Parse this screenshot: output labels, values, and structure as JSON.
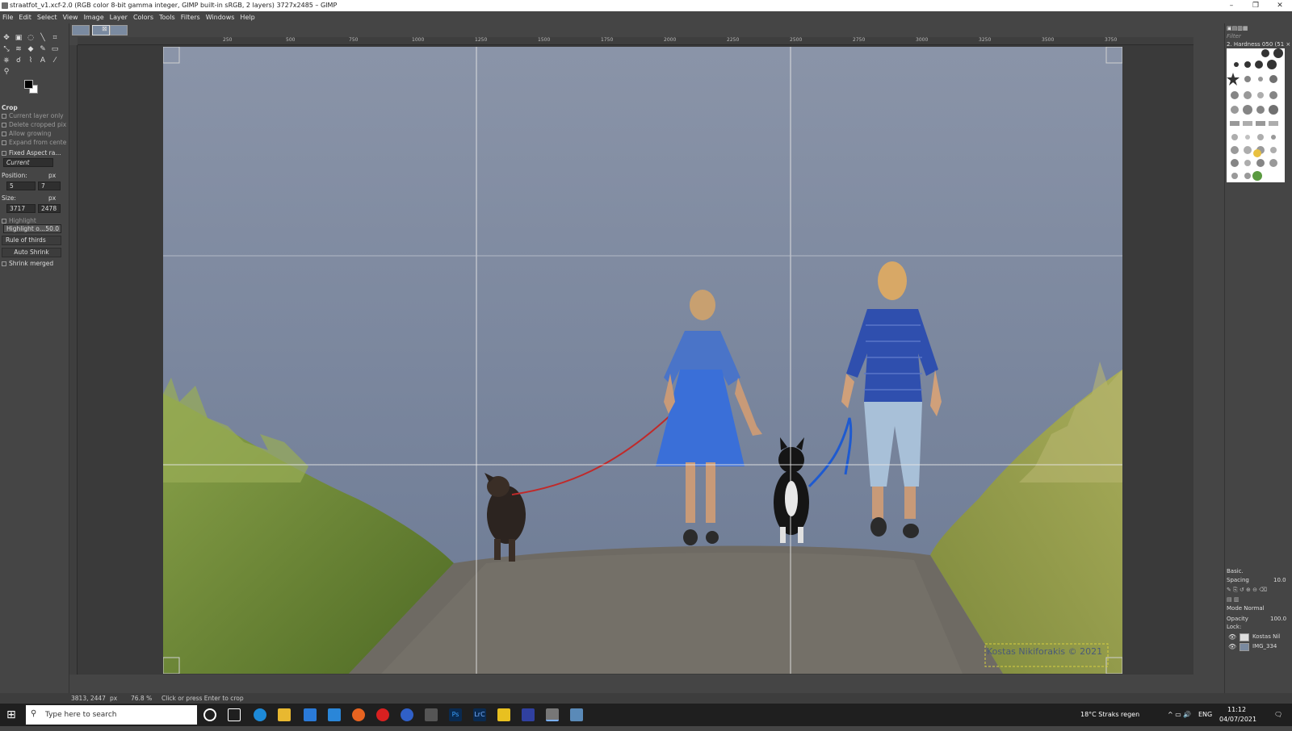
{
  "window": {
    "title": "straatfot_v1.xcf-2.0 (RGB color 8-bit gamma integer, GIMP built-in sRGB, 2 layers) 3727x2485 – GIMP",
    "controls": [
      "–",
      "❐",
      "✕"
    ]
  },
  "menubar": [
    "File",
    "Edit",
    "Select",
    "View",
    "Image",
    "Layer",
    "Colors",
    "Tools",
    "Filters",
    "Windows",
    "Help"
  ],
  "tool_options": {
    "title": "Crop",
    "current_layer_only": "Current layer only",
    "delete_cropped": "Delete cropped pix",
    "allow_growing": "Allow growing",
    "expand_from_center": "Expand from cente",
    "fixed_aspect": "Fixed Aspect ra...",
    "aspect_value": "Current",
    "position_label": "Position:",
    "position_unit": "px",
    "position_x": "5",
    "position_y": "7",
    "size_label": "Size:",
    "size_unit": "px",
    "size_w": "3717",
    "size_h": "2478",
    "highlight": "Highlight",
    "highlight_opacity_label": "Highlight o...",
    "highlight_opacity_value": "50.0",
    "guides": "Rule of thirds",
    "auto_shrink": "Auto Shrink",
    "shrink_merged": "Shrink merged"
  },
  "ruler": {
    "labels": [
      "250",
      "500",
      "750",
      "1000",
      "1250",
      "1500",
      "1750",
      "2000",
      "2250",
      "2500",
      "2750",
      "3000",
      "3250",
      "3500",
      "3750"
    ]
  },
  "dock": {
    "filter_placeholder": "Filter",
    "brush_name": "2. Hardness 050 (51 ×",
    "preset": "Basic.",
    "spacing_label": "Spacing",
    "spacing_value": "10.0",
    "mode_label": "Mode  Normal",
    "opacity_label": "Opacity",
    "opacity_value": "100.0",
    "lock_label": "Lock:",
    "layers": [
      {
        "name": "Kostas Nil"
      },
      {
        "name": "IMG_334"
      }
    ]
  },
  "photo": {
    "watermark": "Kostas Nikiforakis © 2021"
  },
  "status": {
    "coords": "3813, 2447",
    "unit": "px",
    "zoom": "76.8 %",
    "message": "Click or press Enter to crop"
  },
  "taskbar": {
    "search_placeholder": "Type here to search",
    "weather": "18°C  Straks regen",
    "lang": "ENG",
    "time": "11:12",
    "date": "04/07/2021"
  },
  "colors": {
    "sky_top": "#8a94a8",
    "sky_bottom": "#6c7a94",
    "grass": "#6f8a3a",
    "road": "#6e6a63",
    "shirt_blue": "#2f4fae",
    "dress_blue": "#3a6fd8"
  }
}
